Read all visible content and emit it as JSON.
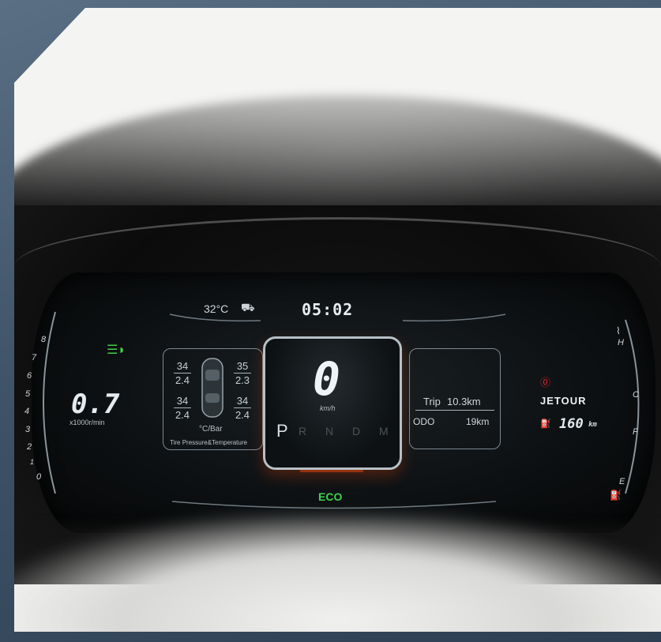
{
  "top_bar": {
    "temperature": "32°C",
    "time": "05:02"
  },
  "tachometer": {
    "scale": [
      "8",
      "7",
      "6",
      "5",
      "4",
      "3",
      "2",
      "1",
      "0"
    ],
    "value": "0.7",
    "unit": "x1000r/min"
  },
  "tire_panel": {
    "front_left": {
      "pressure": "34",
      "temp": "2.4"
    },
    "front_right": {
      "pressure": "35",
      "temp": "2.3"
    },
    "rear_left": {
      "pressure": "34",
      "temp": "2.4"
    },
    "rear_right": {
      "pressure": "34",
      "temp": "2.4"
    },
    "units": "°C/Bar",
    "caption": "Tire Pressure&Temperature"
  },
  "speed": {
    "value": "0",
    "unit": "km/h"
  },
  "gears": {
    "active": "P",
    "inactive": "R N D M"
  },
  "trip_panel": {
    "trip_label": "Trip",
    "trip_value": "10.3km",
    "odo_label": "ODO",
    "odo_value": "19km"
  },
  "brand": "JETOUR",
  "range": "160",
  "range_unit": "km",
  "mode": "ECO",
  "temp_gauge": {
    "hot": "H",
    "cold": "C"
  },
  "fuel_gauge": {
    "full": "F",
    "empty": "E"
  },
  "colors": {
    "eco": "#3fd24a",
    "warning": "#e0262a",
    "headlight": "#3fd24a"
  }
}
